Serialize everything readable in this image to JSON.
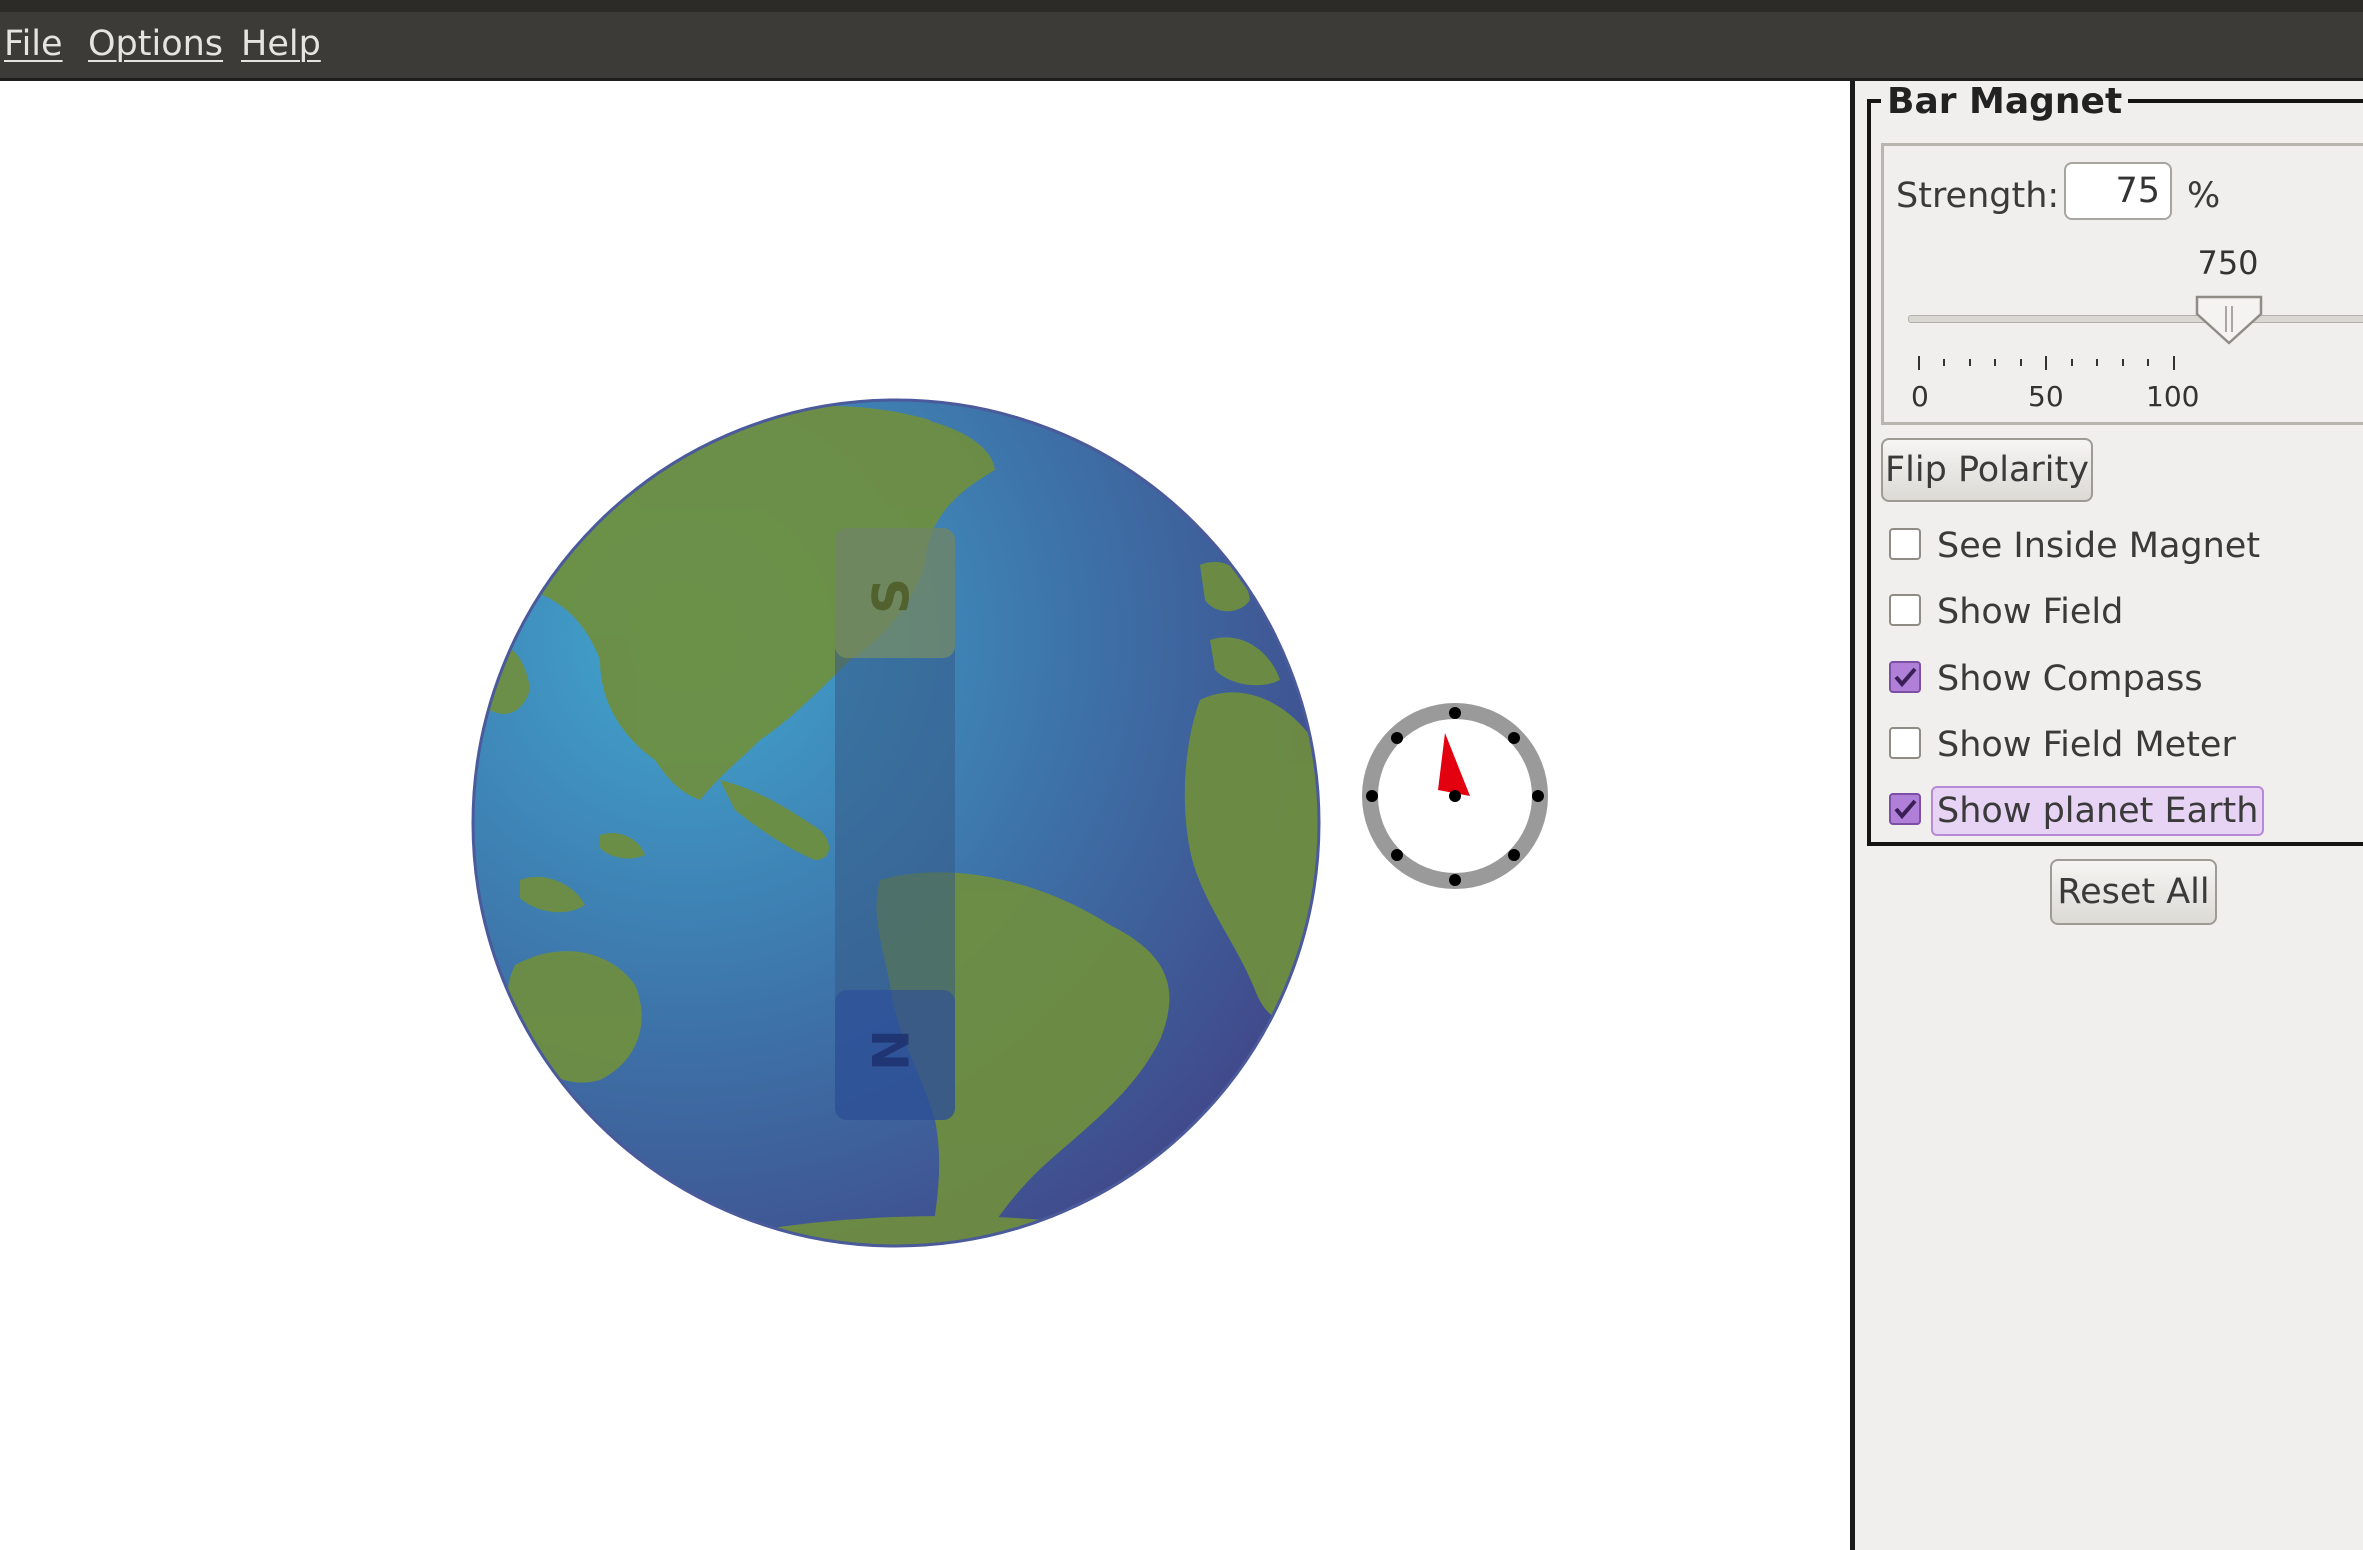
{
  "menu": {
    "items": [
      "File",
      "Options",
      "Help"
    ]
  },
  "magnet": {
    "south_label": "S",
    "north_label": "N"
  },
  "panel": {
    "group_title": "Bar Magnet",
    "strength": {
      "label": "Strength:",
      "value": "75",
      "unit": "%"
    },
    "slider": {
      "value_label": "750",
      "value_fraction": 0.75,
      "min_label": "0",
      "mid_label": "50",
      "max_label": "100"
    },
    "flip_label": "Flip Polarity",
    "checkboxes": [
      {
        "label": "See Inside Magnet",
        "checked": false
      },
      {
        "label": "Show Field",
        "checked": false
      },
      {
        "label": "Show Compass",
        "checked": true
      },
      {
        "label": "Show Field Meter",
        "checked": false
      },
      {
        "label": "Show planet Earth",
        "checked": true
      }
    ],
    "reset_label": "Reset All"
  },
  "colors": {
    "ocean": "#3e79a8",
    "land": "#6f8f3e",
    "magnet_body": "#355a86",
    "compass_needle": "#e3000f",
    "check_accent": "#b07fd8",
    "menubar": "#3c3b37"
  }
}
